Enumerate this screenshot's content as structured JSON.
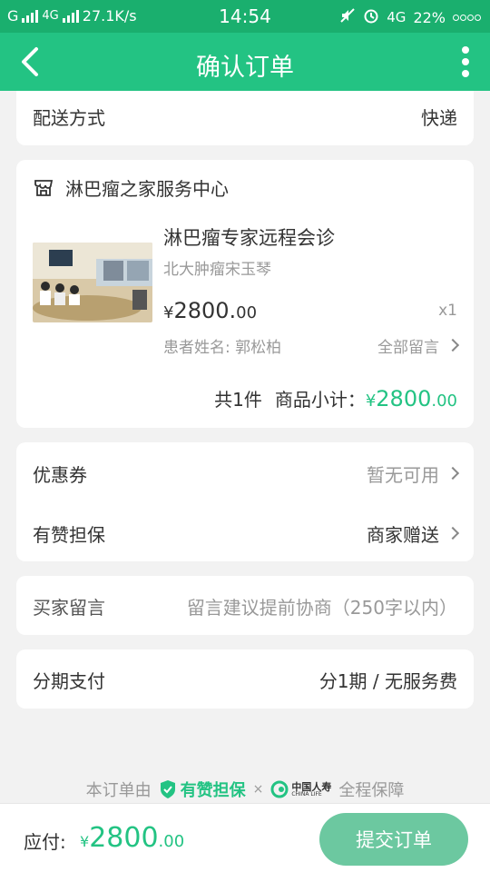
{
  "status_bar": {
    "carrier1": "G",
    "net": "4G",
    "speed": "27.1K/s",
    "time": "14:54",
    "net2": "4G",
    "battery": "22%"
  },
  "nav": {
    "title": "确认订单"
  },
  "delivery": {
    "label": "配送方式",
    "value": "快递"
  },
  "store": {
    "name": "淋巴瘤之家服务中心",
    "product": {
      "title": "淋巴瘤专家远程会诊",
      "subtitle": "北大肿瘤宋玉琴",
      "price_symbol": "¥",
      "price_int": "2800.",
      "price_dec": "00",
      "qty": "x1",
      "patient": "患者姓名: 郭松柏",
      "all_messages": "全部留言"
    },
    "count_text": "共1件",
    "subtotal_label": "商品小计：",
    "subtotal_symbol": "¥",
    "subtotal_int": "2800",
    "subtotal_dec": ".00"
  },
  "coupon": {
    "label": "优惠券",
    "value": "暂无可用"
  },
  "guarantee_row": {
    "label": "有赞担保",
    "value": "商家赠送"
  },
  "buyer_note": {
    "label": "买家留言",
    "placeholder": "留言建议提前协商（250字以内）"
  },
  "installment": {
    "label": "分期支付",
    "value": "分1期 / 无服务费"
  },
  "footer_guarantee": {
    "prefix": "本订单由",
    "brand": "有赞担保",
    "times": "×",
    "insurer": "中国人寿",
    "insurer_en": "CHINA LIFE",
    "suffix": "全程保障"
  },
  "bottom": {
    "pay_label": "应付:",
    "symbol": "¥",
    "amount_int": "2800",
    "amount_dec": ".00",
    "submit": "提交订单"
  },
  "colors": {
    "brand_green": "#23c383",
    "status_green": "#1aaf6e"
  }
}
